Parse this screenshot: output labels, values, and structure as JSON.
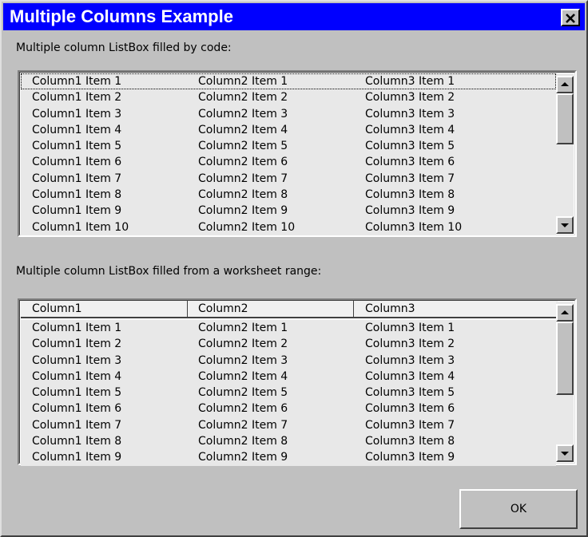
{
  "window": {
    "title": "Multiple Columns Example"
  },
  "listbox1": {
    "caption": "Multiple column ListBox filled by code:",
    "rows": [
      [
        "Column1 Item 1",
        "Column2 Item 1",
        "Column3 Item 1"
      ],
      [
        "Column1 Item 2",
        "Column2 Item 2",
        "Column3 Item 2"
      ],
      [
        "Column1 Item 3",
        "Column2 Item 3",
        "Column3 Item 3"
      ],
      [
        "Column1 Item 4",
        "Column2 Item 4",
        "Column3 Item 4"
      ],
      [
        "Column1 Item 5",
        "Column2 Item 5",
        "Column3 Item 5"
      ],
      [
        "Column1 Item 6",
        "Column2 Item 6",
        "Column3 Item 6"
      ],
      [
        "Column1 Item 7",
        "Column2 Item 7",
        "Column3 Item 7"
      ],
      [
        "Column1 Item 8",
        "Column2 Item 8",
        "Column3 Item 8"
      ],
      [
        "Column1 Item 9",
        "Column2 Item 9",
        "Column3 Item 9"
      ],
      [
        "Column1 Item 10",
        "Column2 Item 10",
        "Column3 Item 10"
      ]
    ]
  },
  "listbox2": {
    "caption": "Multiple column ListBox filled from a worksheet range:",
    "headers": [
      "Column1",
      "Column2",
      "Column3"
    ],
    "rows": [
      [
        "Column1 Item 1",
        "Column2 Item 1",
        "Column3 Item 1"
      ],
      [
        "Column1 Item 2",
        "Column2 Item 2",
        "Column3 Item 2"
      ],
      [
        "Column1 Item 3",
        "Column2 Item 3",
        "Column3 Item 3"
      ],
      [
        "Column1 Item 4",
        "Column2 Item 4",
        "Column3 Item 4"
      ],
      [
        "Column1 Item 5",
        "Column2 Item 5",
        "Column3 Item 5"
      ],
      [
        "Column1 Item 6",
        "Column2 Item 6",
        "Column3 Item 6"
      ],
      [
        "Column1 Item 7",
        "Column2 Item 7",
        "Column3 Item 7"
      ],
      [
        "Column1 Item 8",
        "Column2 Item 8",
        "Column3 Item 8"
      ],
      [
        "Column1 Item 9",
        "Column2 Item 9",
        "Column3 Item 9"
      ]
    ]
  },
  "ok_button": {
    "label": "OK"
  },
  "icons": {
    "close": "close-icon",
    "scroll_up": "arrow-up-icon",
    "scroll_down": "arrow-down-icon"
  },
  "colors": {
    "titlebar": "#0000ff",
    "face": "#c0c0c0",
    "title_text": "#ffffff"
  }
}
